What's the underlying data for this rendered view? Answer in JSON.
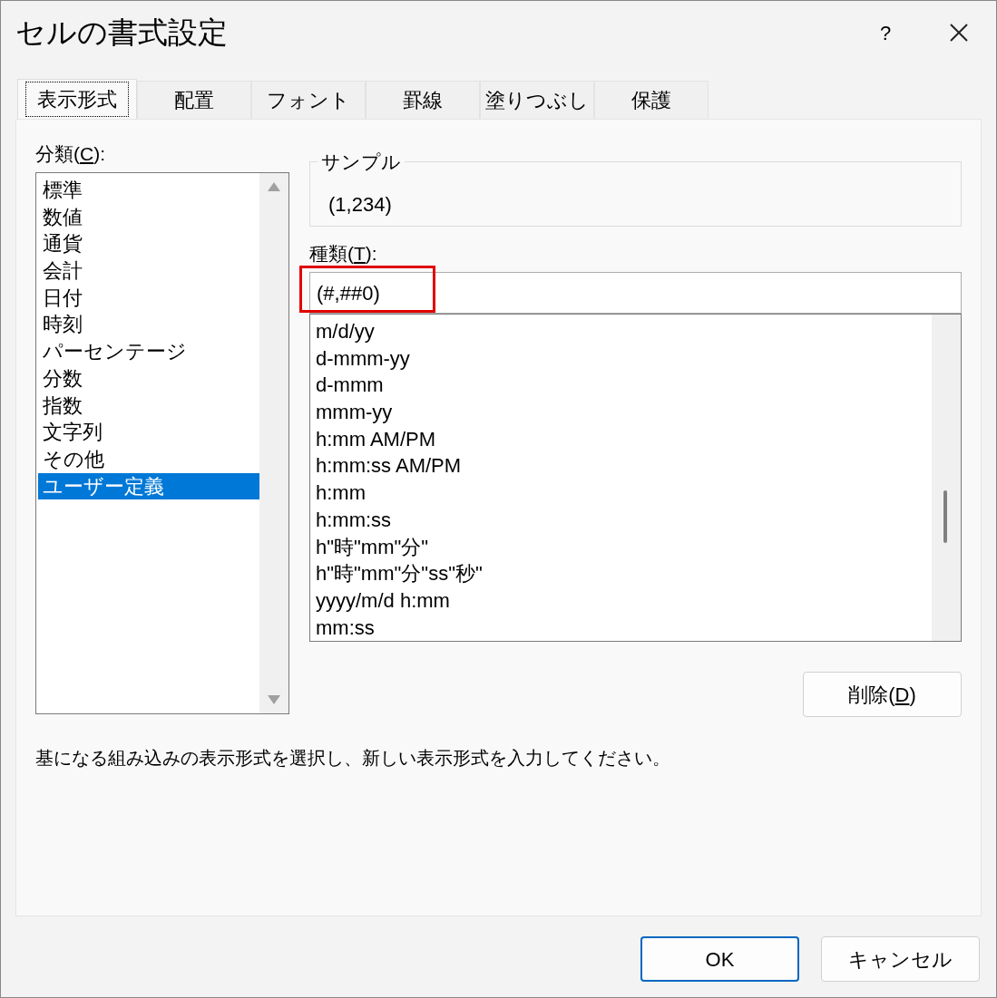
{
  "window": {
    "title": "セルの書式設定",
    "help": "?"
  },
  "tabs": [
    {
      "label": "表示形式",
      "selected": true
    },
    {
      "label": "配置",
      "selected": false
    },
    {
      "label": "フォント",
      "selected": false
    },
    {
      "label": "罫線",
      "selected": false
    },
    {
      "label": "塗りつぶし",
      "selected": false
    },
    {
      "label": "保護",
      "selected": false
    }
  ],
  "category": {
    "label": {
      "before": "分類(",
      "key": "C",
      "after": "):"
    },
    "items": [
      {
        "label": "標準",
        "selected": false
      },
      {
        "label": "数値",
        "selected": false
      },
      {
        "label": "通貨",
        "selected": false
      },
      {
        "label": "会計",
        "selected": false
      },
      {
        "label": "日付",
        "selected": false
      },
      {
        "label": "時刻",
        "selected": false
      },
      {
        "label": "パーセンテージ",
        "selected": false
      },
      {
        "label": "分数",
        "selected": false
      },
      {
        "label": "指数",
        "selected": false
      },
      {
        "label": "文字列",
        "selected": false
      },
      {
        "label": "その他",
        "selected": false
      },
      {
        "label": "ユーザー定義",
        "selected": true
      }
    ]
  },
  "sample": {
    "legend": "サンプル",
    "value": "(1,234)"
  },
  "type": {
    "label": {
      "before": "種類(",
      "key": "T",
      "after": "):"
    },
    "value": "(#,##0)",
    "highlighted": true,
    "items": [
      "m/d/yy",
      "d-mmm-yy",
      "d-mmm",
      "mmm-yy",
      "h:mm AM/PM",
      "h:mm:ss AM/PM",
      "h:mm",
      "h:mm:ss",
      "h\"時\"mm\"分\"",
      "h\"時\"mm\"分\"ss\"秒\"",
      "yyyy/m/d h:mm",
      "mm:ss"
    ]
  },
  "delete_button": {
    "before": "削除(",
    "key": "D",
    "after": ")"
  },
  "description": "基になる組み込みの表示形式を選択し、新しい表示形式を入力してください。",
  "buttons": [
    {
      "label": "OK",
      "kind": "default"
    },
    {
      "label": "キャンセル",
      "kind": "normal"
    }
  ]
}
